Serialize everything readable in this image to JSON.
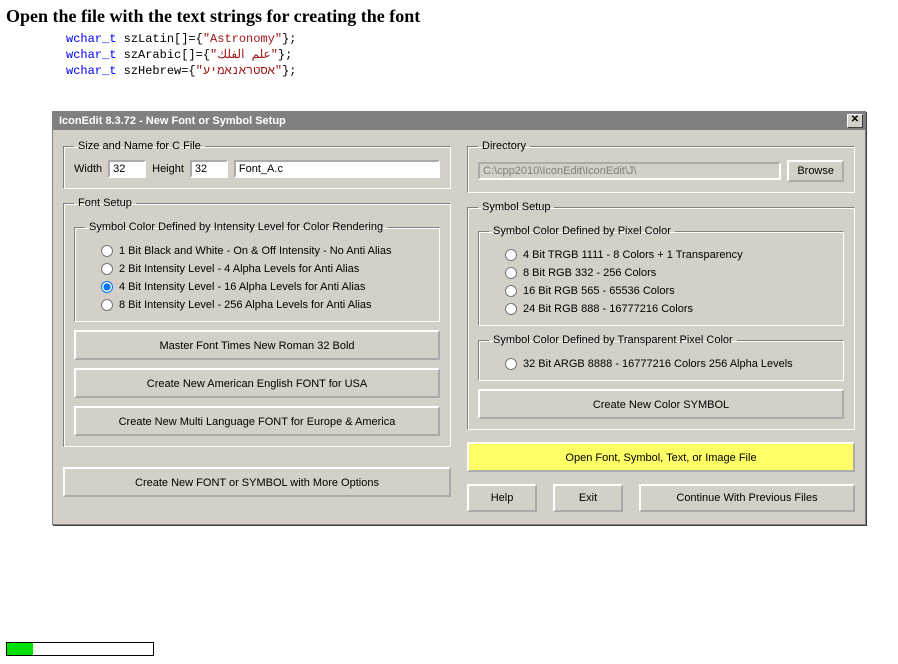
{
  "page_title": "Open the file with the text strings for creating the font",
  "code": {
    "kw": "wchar_t",
    "line1_var": " szLatin[]={",
    "line1_str": "\"Astronomy\"",
    "line1_end": "};",
    "line2_var": " szArabic[]={",
    "line2_str": "\"علم الفلك\"",
    "line2_end": "};",
    "line3_var": " szHebrew={",
    "line3_str": "\"אסטראנאמיע\"",
    "line3_end": "};"
  },
  "dialog": {
    "title": "IconEdit 8.3.72 - New Font or Symbol Setup",
    "close": "✕"
  },
  "size_name": {
    "legend": "Size and Name for C File",
    "width_label": "Width",
    "width_value": "32",
    "height_label": "Height",
    "height_value": "32",
    "filename": "Font_A.c"
  },
  "directory": {
    "legend": "Directory",
    "path": "C:\\cpp2010\\IconEdit\\IconEdit\\J\\",
    "browse": "Browse"
  },
  "font_setup": {
    "legend": "Font Setup",
    "intensity_legend": "Symbol Color Defined by Intensity Level for Color Rendering",
    "radios": [
      "1 Bit Black and White - On & Off Intensity - No Anti Alias",
      "2 Bit Intensity Level - 4 Alpha Levels for Anti Alias",
      "4 Bit Intensity Level - 16 Alpha Levels for Anti Alias",
      "8 Bit Intensity Level - 256 Alpha Levels for Anti Alias"
    ],
    "selected": 2,
    "buttons": [
      "Master Font  Times New Roman 32 Bold",
      "Create New American English FONT for USA",
      "Create New Multi Language FONT for Europe & America"
    ]
  },
  "symbol_setup": {
    "legend": "Symbol Setup",
    "pixel_legend": "Symbol Color Defined by Pixel Color",
    "pixel_radios": [
      "4 Bit TRGB 1111 - 8 Colors + 1 Transparency",
      "8 Bit RGB 332 - 256 Colors",
      "16 Bit RGB 565 - 65536 Colors",
      "24 Bit RGB 888 - 16777216 Colors"
    ],
    "transparent_legend": "Symbol Color Defined by Transparent Pixel Color",
    "transparent_radio": "32 Bit ARGB 8888 - 16777216 Colors 256 Alpha Levels",
    "create_symbol": "Create New Color SYMBOL",
    "open_file": "Open Font, Symbol, Text, or Image File"
  },
  "bottom": {
    "more_options": "Create New FONT or SYMBOL with More Options",
    "help": "Help",
    "exit": "Exit",
    "continue": "Continue With Previous Files"
  },
  "progress_percent": 18
}
